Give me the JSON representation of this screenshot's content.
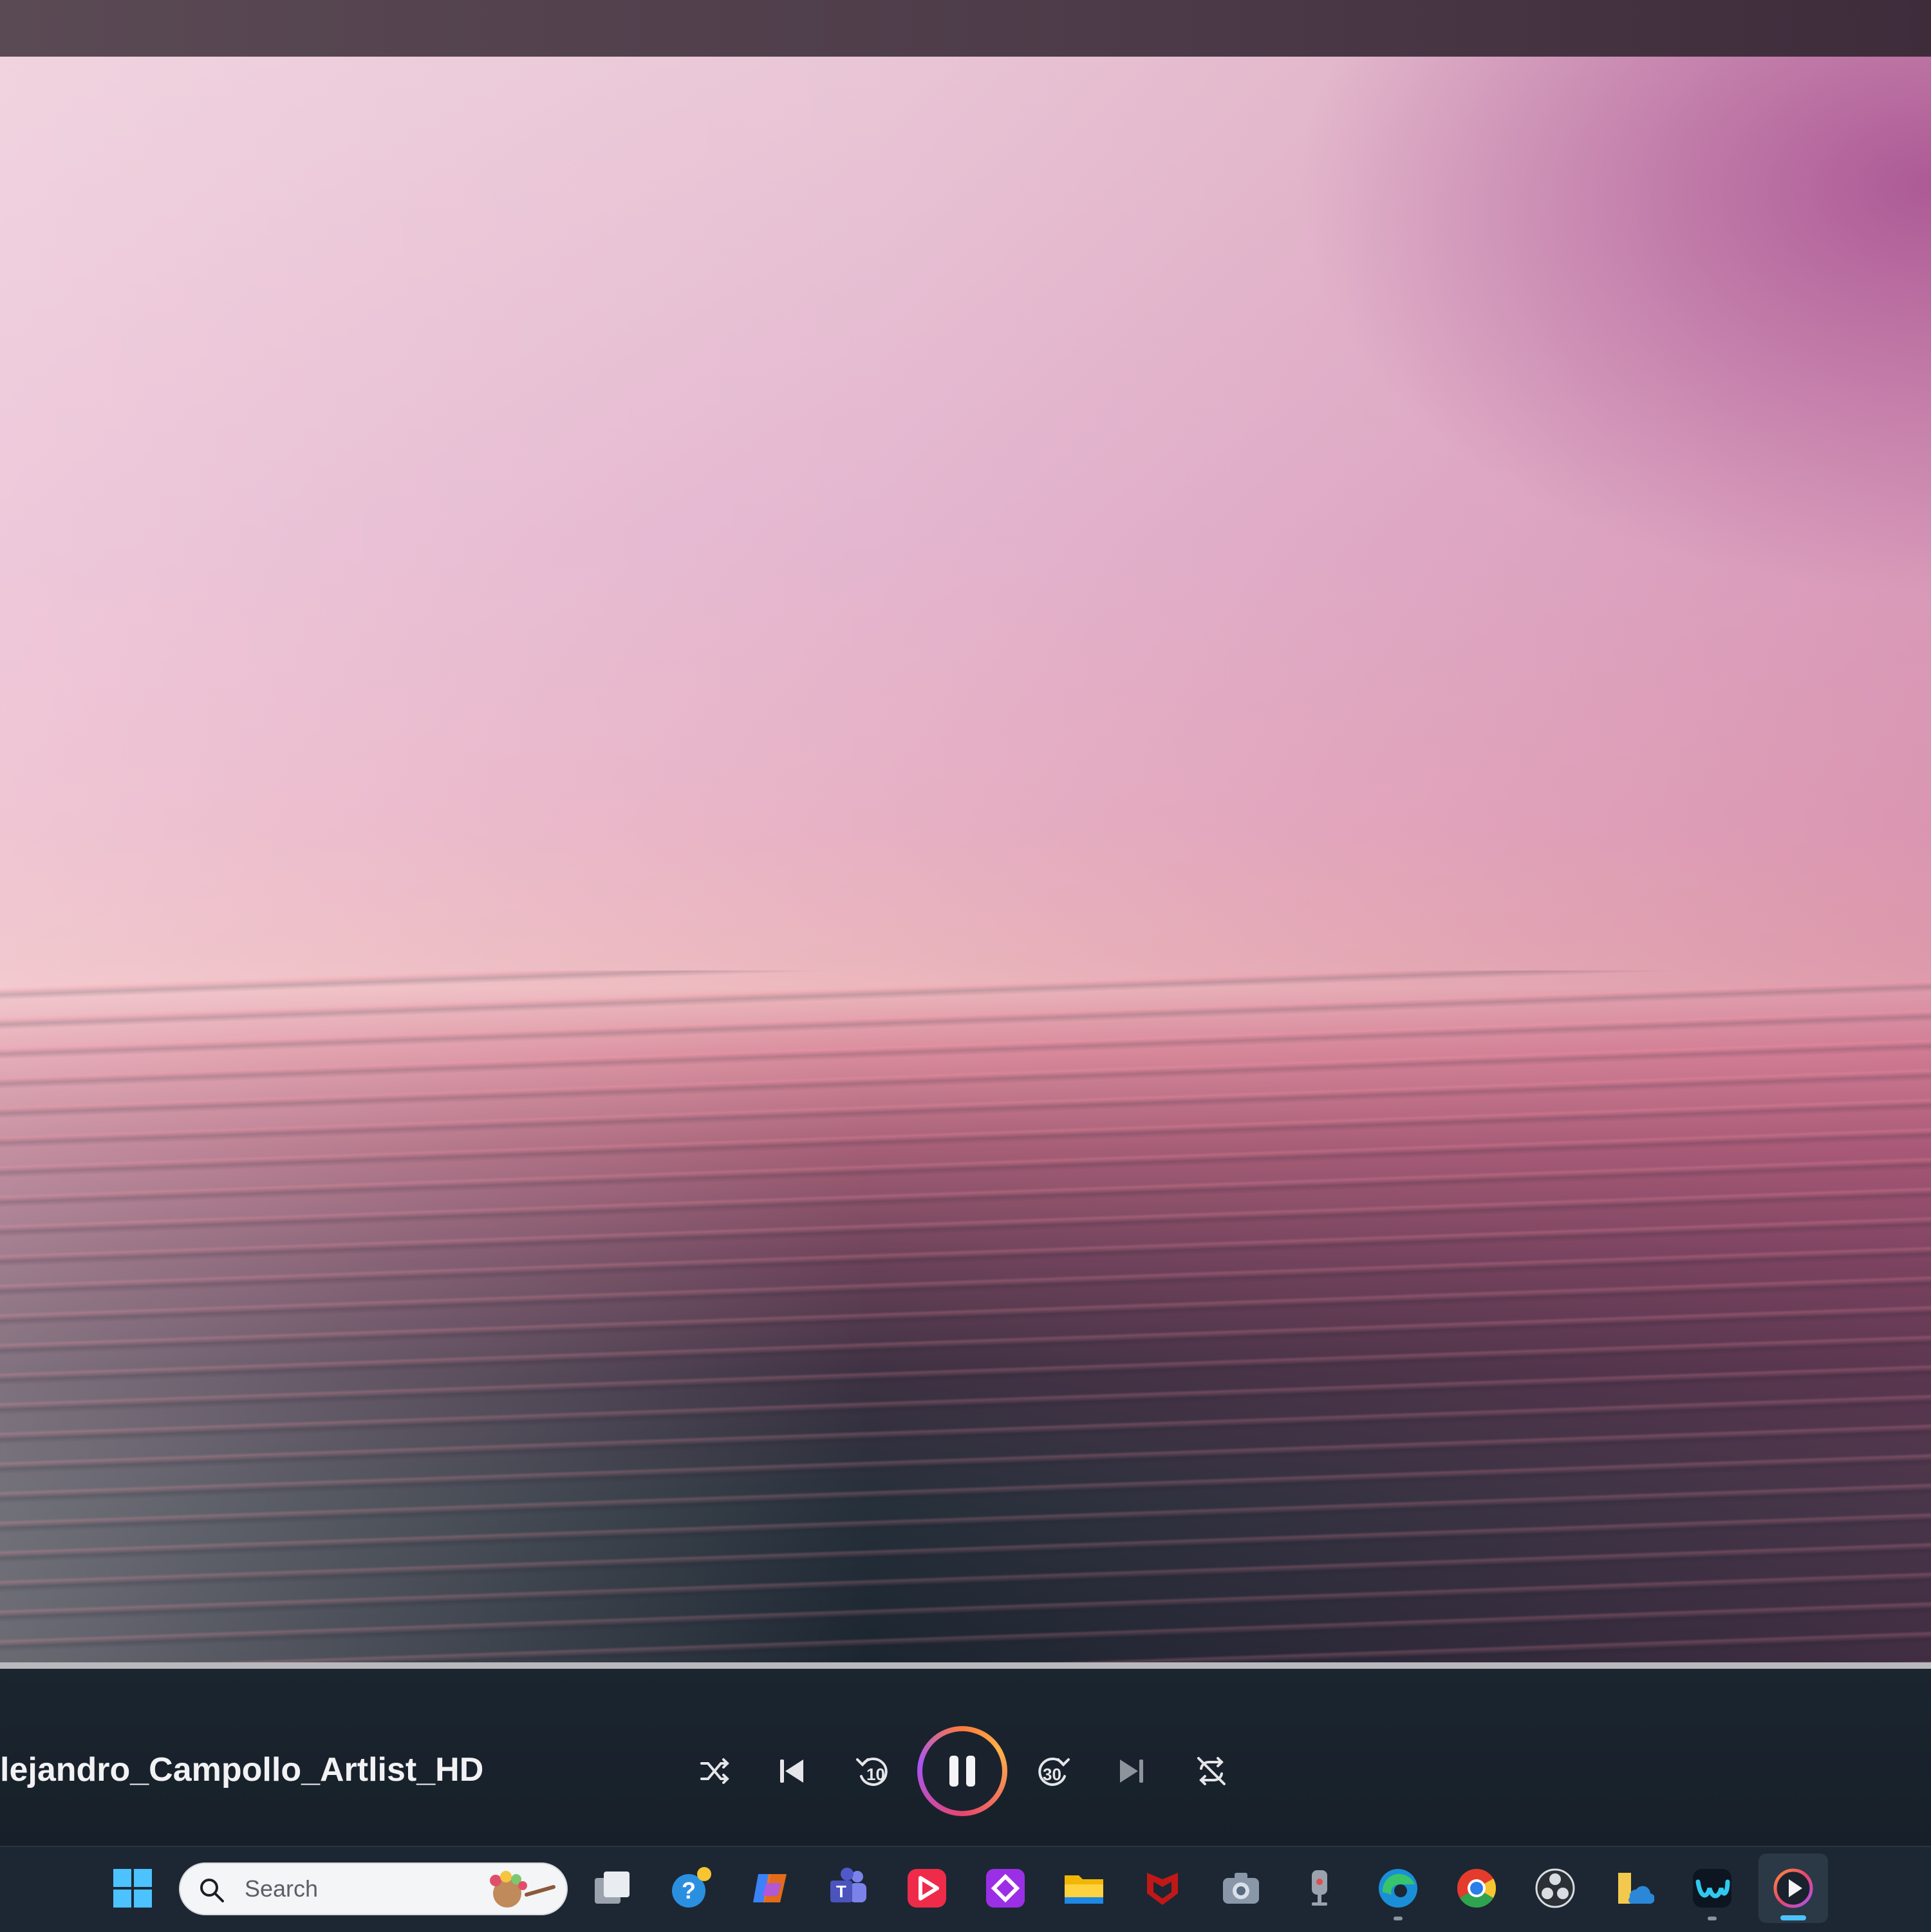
{
  "player": {
    "track_title": "lejandro_Campollo_Artlist_HD",
    "progress_fraction": 0.0,
    "state": "playing",
    "skip_back_seconds": "10",
    "skip_forward_seconds": "30",
    "controls": [
      "shuffle-icon",
      "previous-icon",
      "skip-back-10-icon",
      "pause-icon",
      "skip-forward-30-icon",
      "next-icon",
      "repeat-off-icon"
    ]
  },
  "taskbar": {
    "search_placeholder": "Search",
    "pinned_icons": [
      "windows-start-icon",
      "search-box",
      "task-view-icon",
      "get-help-icon",
      "copilot-icon",
      "teams-icon",
      "video-editor-icon",
      "purple-diamond-app-icon",
      "file-explorer-icon",
      "mcafee-icon",
      "camera-icon",
      "voice-recorder-icon",
      "edge-icon",
      "chrome-icon",
      "obs-icon",
      "onedrive-folder-icon",
      "webex-icon",
      "media-player-icon"
    ],
    "accent_color": "#4cc2ff"
  },
  "colors": {
    "control_bar": "#1a232d",
    "play_ring_gradient": [
      "#ff7a3d",
      "#e8456d",
      "#a855f7"
    ]
  }
}
